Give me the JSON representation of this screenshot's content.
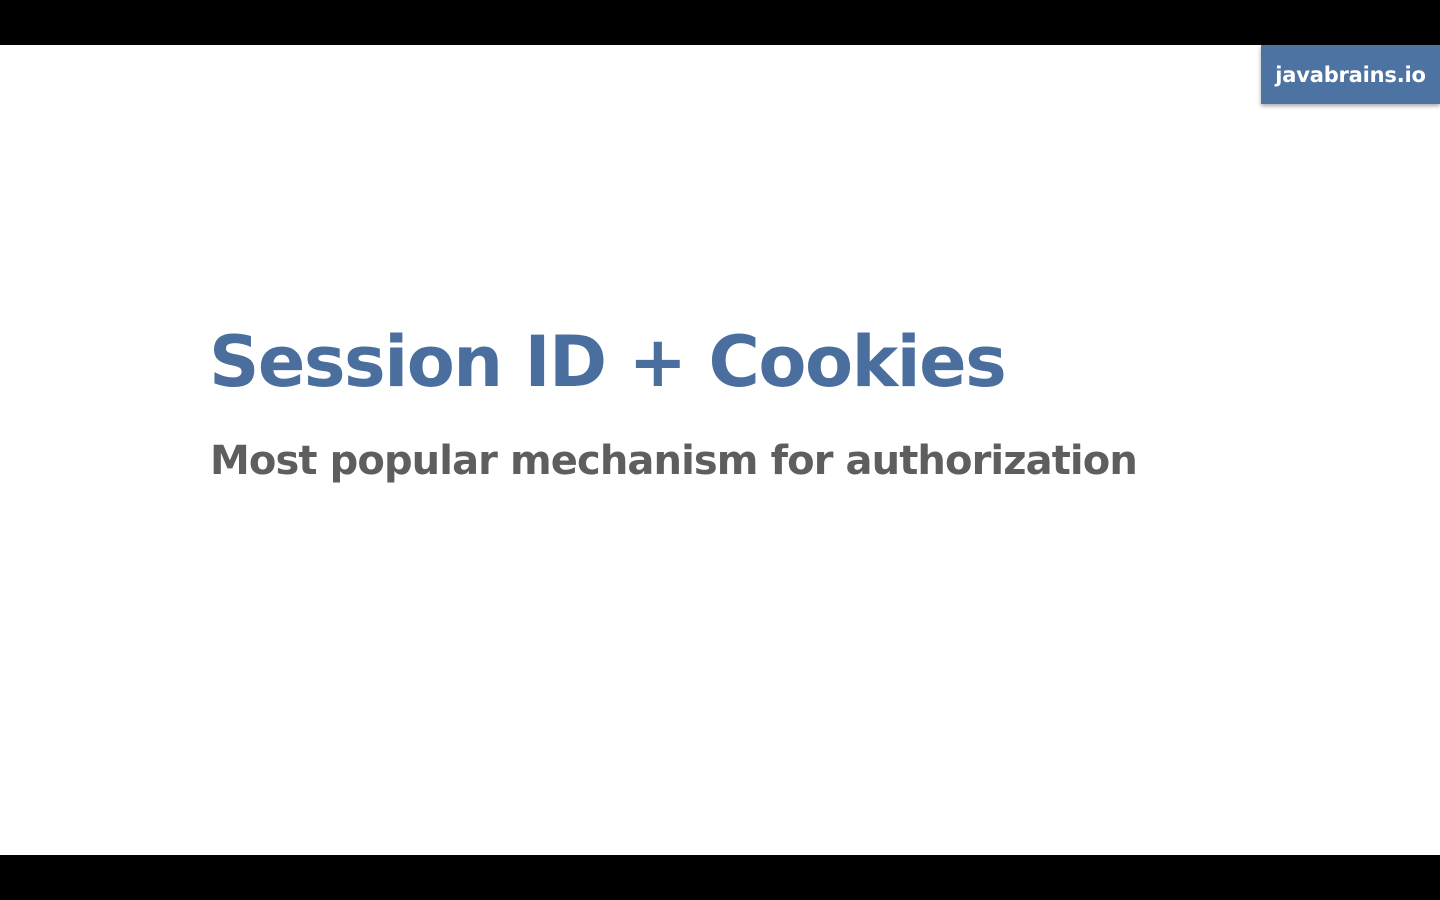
{
  "brand": {
    "label": "javabrains.io",
    "color": "#4d73a3"
  },
  "slide": {
    "title": "Session ID + Cookies",
    "subtitle": "Most popular mechanism for authorization",
    "title_color": "#4a6f9e",
    "subtitle_color": "#5e5e5e"
  }
}
